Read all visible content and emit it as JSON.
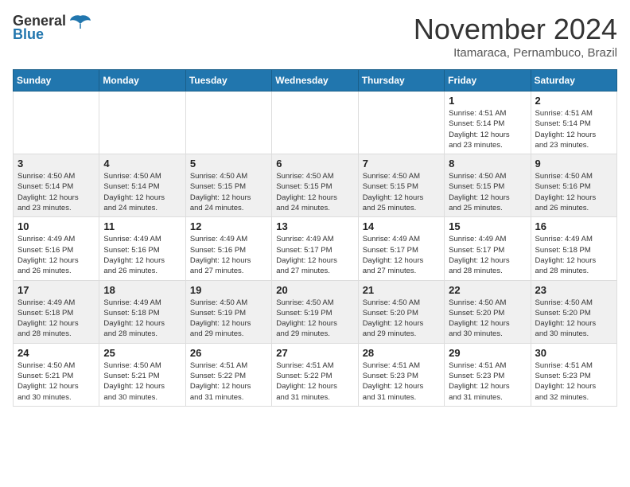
{
  "header": {
    "logo_line1": "General",
    "logo_line2": "Blue",
    "title": "November 2024",
    "subtitle": "Itamaraca, Pernambuco, Brazil"
  },
  "weekdays": [
    "Sunday",
    "Monday",
    "Tuesday",
    "Wednesday",
    "Thursday",
    "Friday",
    "Saturday"
  ],
  "weeks": [
    [
      {
        "day": "",
        "info": ""
      },
      {
        "day": "",
        "info": ""
      },
      {
        "day": "",
        "info": ""
      },
      {
        "day": "",
        "info": ""
      },
      {
        "day": "",
        "info": ""
      },
      {
        "day": "1",
        "info": "Sunrise: 4:51 AM\nSunset: 5:14 PM\nDaylight: 12 hours\nand 23 minutes."
      },
      {
        "day": "2",
        "info": "Sunrise: 4:51 AM\nSunset: 5:14 PM\nDaylight: 12 hours\nand 23 minutes."
      }
    ],
    [
      {
        "day": "3",
        "info": "Sunrise: 4:50 AM\nSunset: 5:14 PM\nDaylight: 12 hours\nand 23 minutes."
      },
      {
        "day": "4",
        "info": "Sunrise: 4:50 AM\nSunset: 5:14 PM\nDaylight: 12 hours\nand 24 minutes."
      },
      {
        "day": "5",
        "info": "Sunrise: 4:50 AM\nSunset: 5:15 PM\nDaylight: 12 hours\nand 24 minutes."
      },
      {
        "day": "6",
        "info": "Sunrise: 4:50 AM\nSunset: 5:15 PM\nDaylight: 12 hours\nand 24 minutes."
      },
      {
        "day": "7",
        "info": "Sunrise: 4:50 AM\nSunset: 5:15 PM\nDaylight: 12 hours\nand 25 minutes."
      },
      {
        "day": "8",
        "info": "Sunrise: 4:50 AM\nSunset: 5:15 PM\nDaylight: 12 hours\nand 25 minutes."
      },
      {
        "day": "9",
        "info": "Sunrise: 4:50 AM\nSunset: 5:16 PM\nDaylight: 12 hours\nand 26 minutes."
      }
    ],
    [
      {
        "day": "10",
        "info": "Sunrise: 4:49 AM\nSunset: 5:16 PM\nDaylight: 12 hours\nand 26 minutes."
      },
      {
        "day": "11",
        "info": "Sunrise: 4:49 AM\nSunset: 5:16 PM\nDaylight: 12 hours\nand 26 minutes."
      },
      {
        "day": "12",
        "info": "Sunrise: 4:49 AM\nSunset: 5:16 PM\nDaylight: 12 hours\nand 27 minutes."
      },
      {
        "day": "13",
        "info": "Sunrise: 4:49 AM\nSunset: 5:17 PM\nDaylight: 12 hours\nand 27 minutes."
      },
      {
        "day": "14",
        "info": "Sunrise: 4:49 AM\nSunset: 5:17 PM\nDaylight: 12 hours\nand 27 minutes."
      },
      {
        "day": "15",
        "info": "Sunrise: 4:49 AM\nSunset: 5:17 PM\nDaylight: 12 hours\nand 28 minutes."
      },
      {
        "day": "16",
        "info": "Sunrise: 4:49 AM\nSunset: 5:18 PM\nDaylight: 12 hours\nand 28 minutes."
      }
    ],
    [
      {
        "day": "17",
        "info": "Sunrise: 4:49 AM\nSunset: 5:18 PM\nDaylight: 12 hours\nand 28 minutes."
      },
      {
        "day": "18",
        "info": "Sunrise: 4:49 AM\nSunset: 5:18 PM\nDaylight: 12 hours\nand 28 minutes."
      },
      {
        "day": "19",
        "info": "Sunrise: 4:50 AM\nSunset: 5:19 PM\nDaylight: 12 hours\nand 29 minutes."
      },
      {
        "day": "20",
        "info": "Sunrise: 4:50 AM\nSunset: 5:19 PM\nDaylight: 12 hours\nand 29 minutes."
      },
      {
        "day": "21",
        "info": "Sunrise: 4:50 AM\nSunset: 5:20 PM\nDaylight: 12 hours\nand 29 minutes."
      },
      {
        "day": "22",
        "info": "Sunrise: 4:50 AM\nSunset: 5:20 PM\nDaylight: 12 hours\nand 30 minutes."
      },
      {
        "day": "23",
        "info": "Sunrise: 4:50 AM\nSunset: 5:20 PM\nDaylight: 12 hours\nand 30 minutes."
      }
    ],
    [
      {
        "day": "24",
        "info": "Sunrise: 4:50 AM\nSunset: 5:21 PM\nDaylight: 12 hours\nand 30 minutes."
      },
      {
        "day": "25",
        "info": "Sunrise: 4:50 AM\nSunset: 5:21 PM\nDaylight: 12 hours\nand 30 minutes."
      },
      {
        "day": "26",
        "info": "Sunrise: 4:51 AM\nSunset: 5:22 PM\nDaylight: 12 hours\nand 31 minutes."
      },
      {
        "day": "27",
        "info": "Sunrise: 4:51 AM\nSunset: 5:22 PM\nDaylight: 12 hours\nand 31 minutes."
      },
      {
        "day": "28",
        "info": "Sunrise: 4:51 AM\nSunset: 5:23 PM\nDaylight: 12 hours\nand 31 minutes."
      },
      {
        "day": "29",
        "info": "Sunrise: 4:51 AM\nSunset: 5:23 PM\nDaylight: 12 hours\nand 31 minutes."
      },
      {
        "day": "30",
        "info": "Sunrise: 4:51 AM\nSunset: 5:23 PM\nDaylight: 12 hours\nand 32 minutes."
      }
    ]
  ]
}
